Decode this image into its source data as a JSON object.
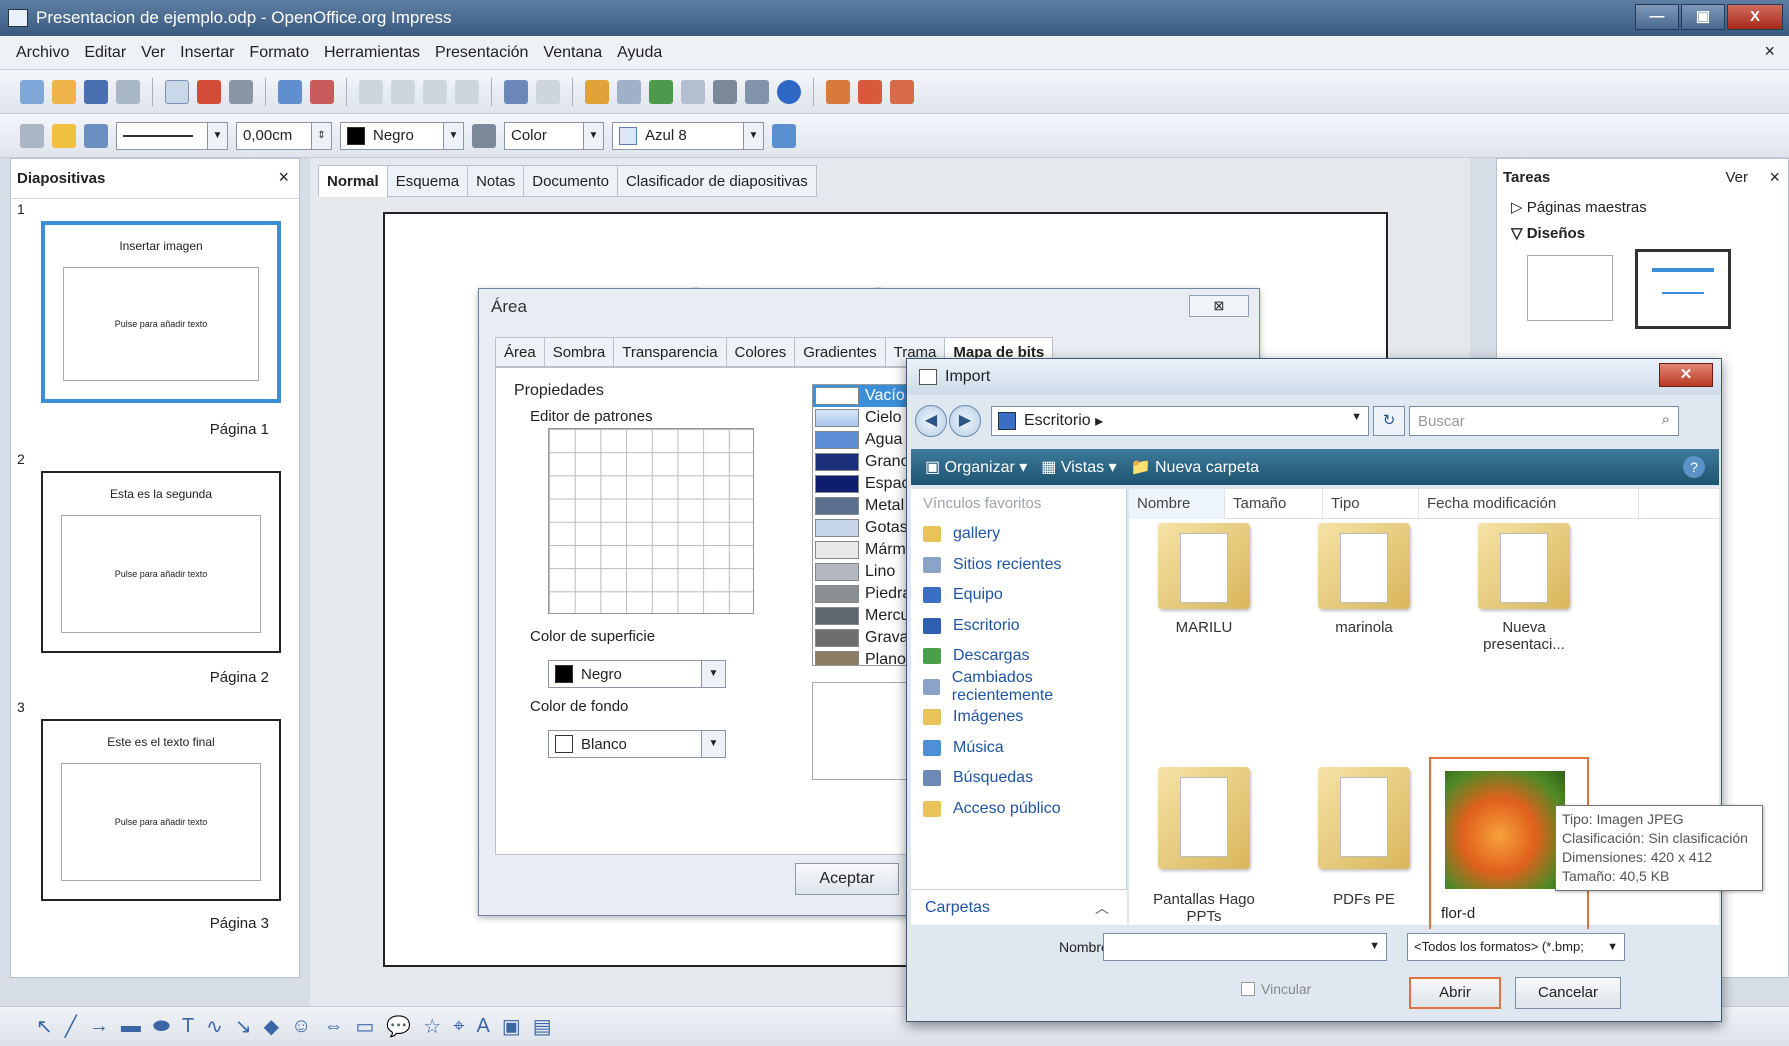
{
  "window": {
    "title": "Presentacion de ejemplo.odp - OpenOffice.org Impress",
    "min": "—",
    "max": "▣",
    "close": "X"
  },
  "menu": {
    "items": [
      "Archivo",
      "Editar",
      "Ver",
      "Insertar",
      "Formato",
      "Herramientas",
      "Presentación",
      "Ventana",
      "Ayuda"
    ],
    "close": "×"
  },
  "linebar": {
    "width": "0,00cm",
    "line_color": "Negro",
    "fill_type": "Color",
    "fill_color": "Azul 8"
  },
  "slides_pane": {
    "title": "Diapositivas",
    "close": "×",
    "slides": [
      {
        "num": "1",
        "title": "Insertar imagen",
        "body": "Pulse para añadir texto",
        "label": "Página 1"
      },
      {
        "num": "2",
        "title": "Esta es la segunda",
        "body": "Pulse para añadir texto",
        "label": "Página 2"
      },
      {
        "num": "3",
        "title": "Este es el texto final",
        "body": "Pulse para añadir texto",
        "label": "Página 3"
      }
    ]
  },
  "view_tabs": [
    "Normal",
    "Esquema",
    "Notas",
    "Documento",
    "Clasificador de diapositivas"
  ],
  "slide": {
    "title": "insertar imagen"
  },
  "tasks_pane": {
    "title": "Tareas",
    "ver": "Ver",
    "close": "×",
    "section1": "▷ Páginas maestras",
    "section2": "▽ Diseños"
  },
  "area_dialog": {
    "title": "Área",
    "close": "⊠",
    "tabs": [
      "Área",
      "Sombra",
      "Transparencia",
      "Colores",
      "Gradientes",
      "Trama",
      "Mapa de bits"
    ],
    "properties": "Propiedades",
    "pattern_editor": "Editor de patrones",
    "surface_color_label": "Color de superficie",
    "surface_color": "Negro",
    "bg_color_label": "Color de fondo",
    "bg_color": "Blanco",
    "bitmaps": [
      "Vacío",
      "Cielo",
      "Agua",
      "Grano",
      "Espaci",
      "Metal",
      "Gotas",
      "Mármo",
      "Lino",
      "Piedra",
      "Mercu",
      "Grava",
      "Plano"
    ],
    "accept": "Aceptar"
  },
  "import_dialog": {
    "title": "Import",
    "location": "Escritorio",
    "search_placeholder": "Buscar",
    "commands": {
      "organize": "Organizar",
      "views": "Vistas",
      "new_folder": "Nueva carpeta"
    },
    "favorites_header": "Vínculos favoritos",
    "favorites": [
      "gallery",
      "Sitios recientes",
      "Equipo",
      "Escritorio",
      "Descargas",
      "Cambiados recientemente",
      "Imágenes",
      "Música",
      "Búsquedas",
      "Acceso público"
    ],
    "folders_label": "Carpetas",
    "columns": [
      "Nombre",
      "Tamaño",
      "Tipo",
      "Fecha modificación"
    ],
    "files": [
      {
        "name": "MARILU"
      },
      {
        "name": "marinola"
      },
      {
        "name": "Nueva presentaci..."
      },
      {
        "name": "Pantallas Hago PPTs"
      },
      {
        "name": "PDFs PE"
      },
      {
        "name": "flor-d"
      }
    ],
    "tooltip": {
      "type": "Tipo: Imagen JPEG",
      "rating": "Clasificación: Sin clasificación",
      "dimensions": "Dimensiones: 420 x 412",
      "size": "Tamaño: 40,5 KB"
    },
    "name_label": "Nombre:",
    "file_name": "",
    "format": "<Todos los formatos> (*.bmp;",
    "link_label": "Vincular",
    "open": "Abrir",
    "cancel": "Cancelar"
  }
}
